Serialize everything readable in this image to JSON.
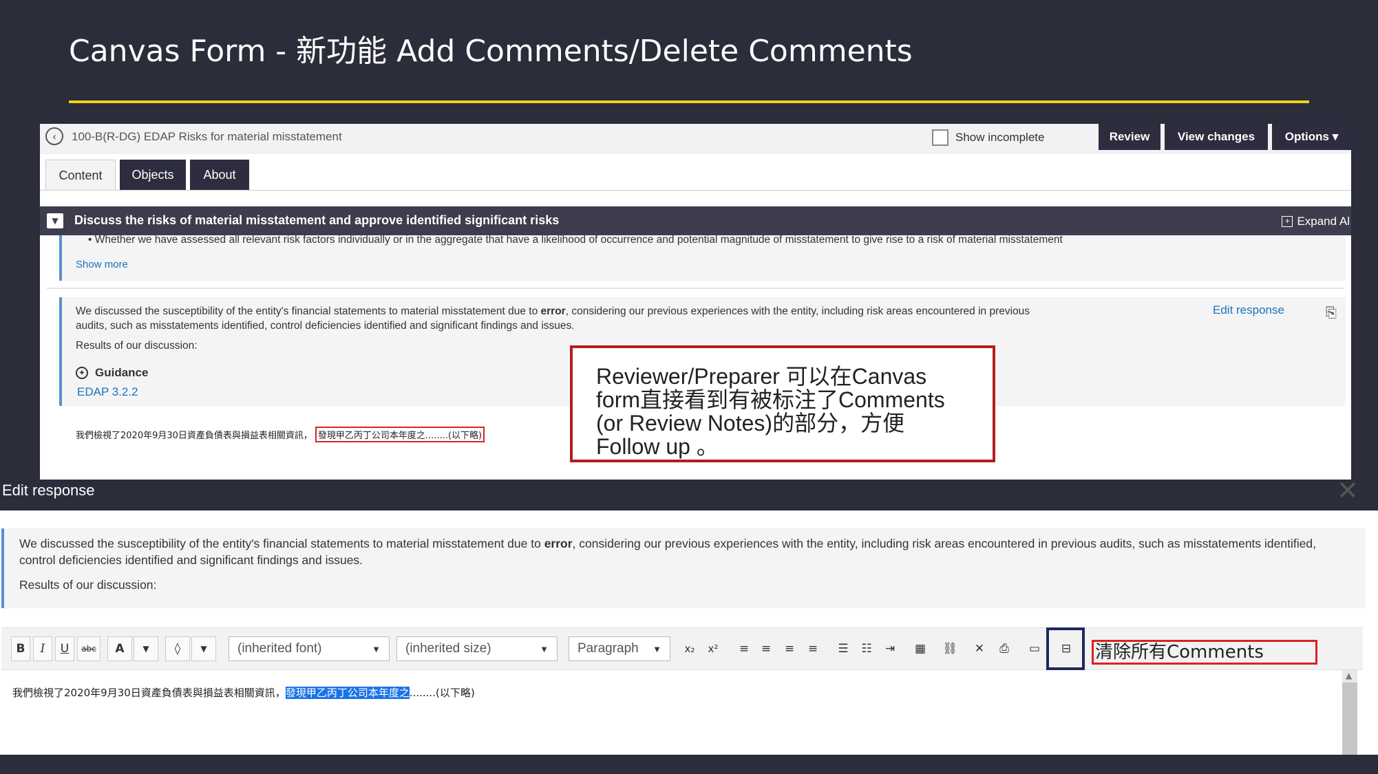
{
  "slide": {
    "title": "Canvas Form - 新功能 Add Comments/Delete Comments"
  },
  "canvas": {
    "doc_title": "100-B(R-DG) EDAP Risks for material misstatement",
    "show_incomplete": "Show incomplete",
    "buttons": {
      "review": "Review",
      "view_changes": "View changes",
      "options": "Options ▾"
    },
    "tabs": [
      "Content",
      "Objects",
      "About"
    ],
    "section_title": "Discuss the risks of material misstatement and approve identified significant risks",
    "expand_all": "Expand Al",
    "bullet_text": "Whether we have assessed all relevant risk factors individually or in the aggregate that have a likelihood of occurrence and potential magnitude of misstatement to give rise to a risk of material misstatement",
    "show_more": "Show more",
    "response_pre": "We discussed the susceptibility of the entity's financial statements to material misstatement due to ",
    "response_bold": "error",
    "response_post": ", considering our previous experiences with the entity, including risk areas encountered in previous audits, such as misstatements identified, control deficiencies identified and significant findings and issues.",
    "results": "Results of our discussion:",
    "edit_response": "Edit response",
    "guidance": "Guidance",
    "edap_link": "EDAP 3.2.2",
    "cn_text": "我們檢視了2020年9月30日資產負債表與損益表相關資訊，",
    "cn_boxed": "發現甲乙丙丁公司本年度之........(以下略)"
  },
  "callout": {
    "text": "Reviewer/Preparer 可以在Canvas form直接看到有被标注了Comments (or Review Notes)的部分，方便 Follow up 。"
  },
  "editor": {
    "title": "Edit response",
    "response_pre": "We discussed the susceptibility of the entity's financial statements to material misstatement due to ",
    "response_bold": "error",
    "response_post": ", considering our previous experiences with the entity, including risk areas encountered in previous audits, such as misstatements identified, control deficiencies identified and significant findings and issues.",
    "results": "Results of our discussion:",
    "font_select": "(inherited font)",
    "size_select": "(inherited size)",
    "paragraph_select": "Paragraph",
    "clear_label": "清除所有Comments",
    "line_prefix": "我們檢視了2020年9月30日資產負債表與損益表相關資訊，",
    "line_selected": "發現甲乙丙丁公司本年度之",
    "line_suffix": "........(以下略)"
  }
}
